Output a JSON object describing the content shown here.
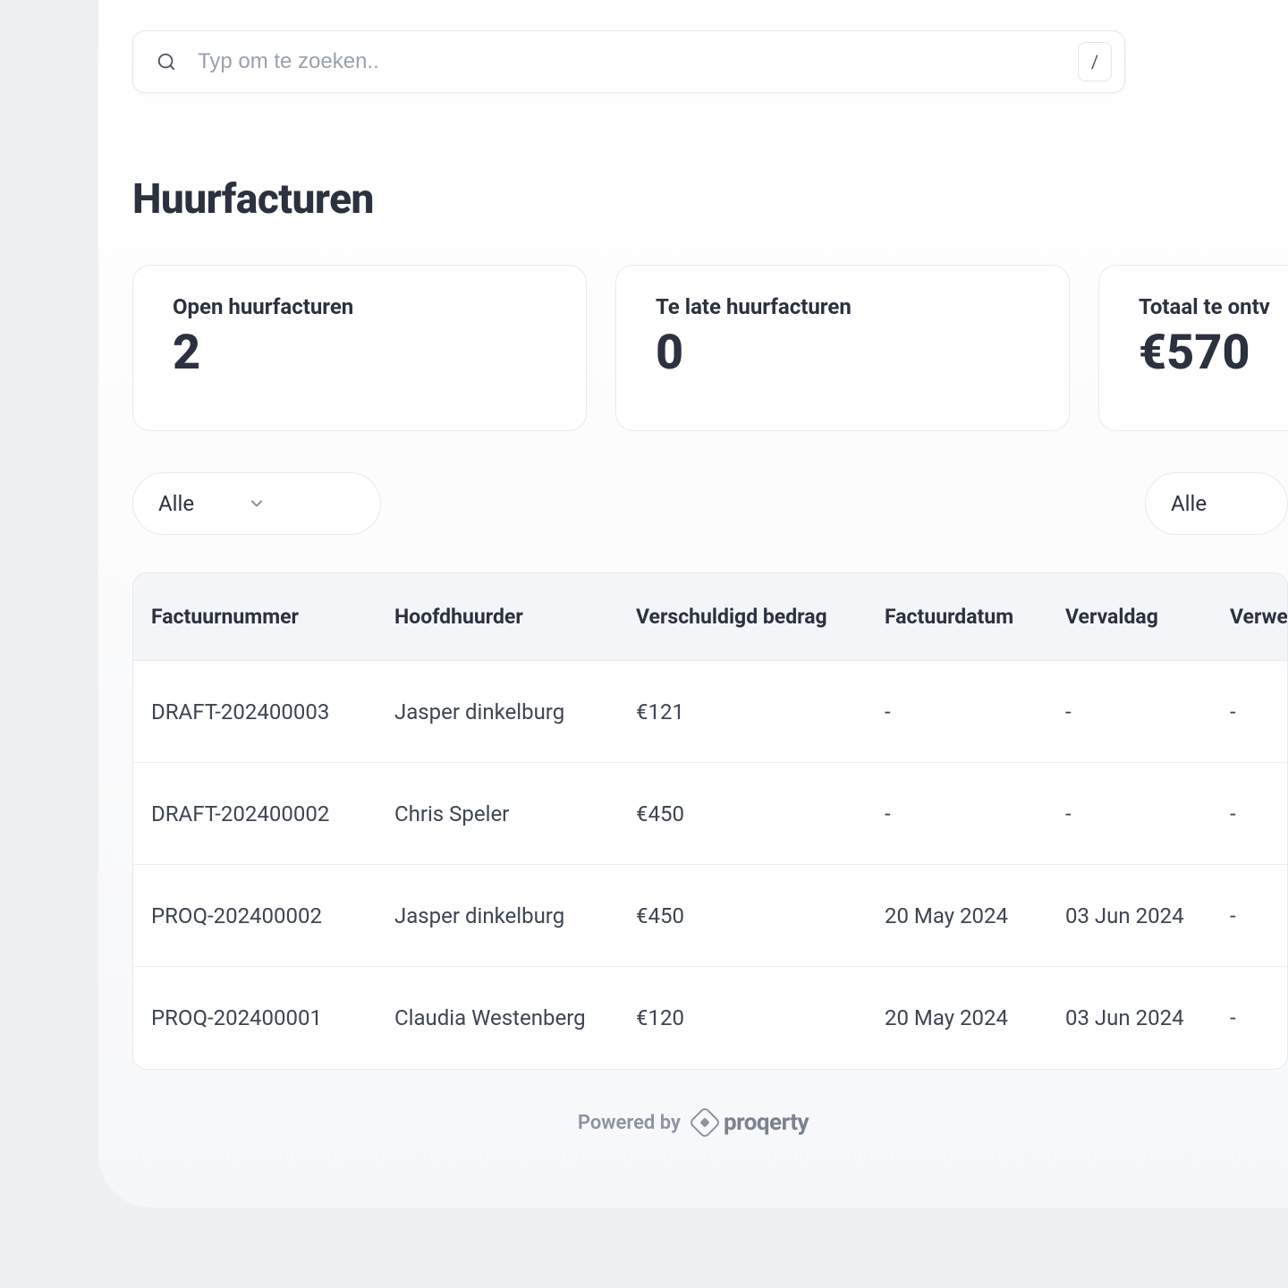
{
  "search": {
    "placeholder": "Typ om te zoeken..",
    "shortcut": "/"
  },
  "title": "Huurfacturen",
  "cards": [
    {
      "label": "Open huurfacturen",
      "value": "2"
    },
    {
      "label": "Te late huurfacturen",
      "value": "0"
    },
    {
      "label": "Totaal te ontv",
      "value": "€570"
    }
  ],
  "filters": {
    "left": "Alle",
    "right": "Alle"
  },
  "table": {
    "headers": [
      "Factuurnummer",
      "Hoofdhuurder",
      "Verschuldigd bedrag",
      "Factuurdatum",
      "Vervaldag",
      "Verwer"
    ],
    "rows": [
      {
        "num": "DRAFT-202400003",
        "tenant": "Jasper dinkelburg",
        "amount": "€121",
        "date": "-",
        "due": "-",
        "proc": "-"
      },
      {
        "num": "DRAFT-202400002",
        "tenant": "Chris Speler",
        "amount": "€450",
        "date": "-",
        "due": "-",
        "proc": "-"
      },
      {
        "num": "PROQ-202400002",
        "tenant": "Jasper dinkelburg",
        "amount": "€450",
        "date": "20 May 2024",
        "due": "03 Jun 2024",
        "proc": "-"
      },
      {
        "num": "PROQ-202400001",
        "tenant": "Claudia Westenberg",
        "amount": "€120",
        "date": "20 May 2024",
        "due": "03 Jun 2024",
        "proc": "-"
      }
    ]
  },
  "footer": {
    "powered": "Powered by",
    "brand": "proqerty"
  }
}
